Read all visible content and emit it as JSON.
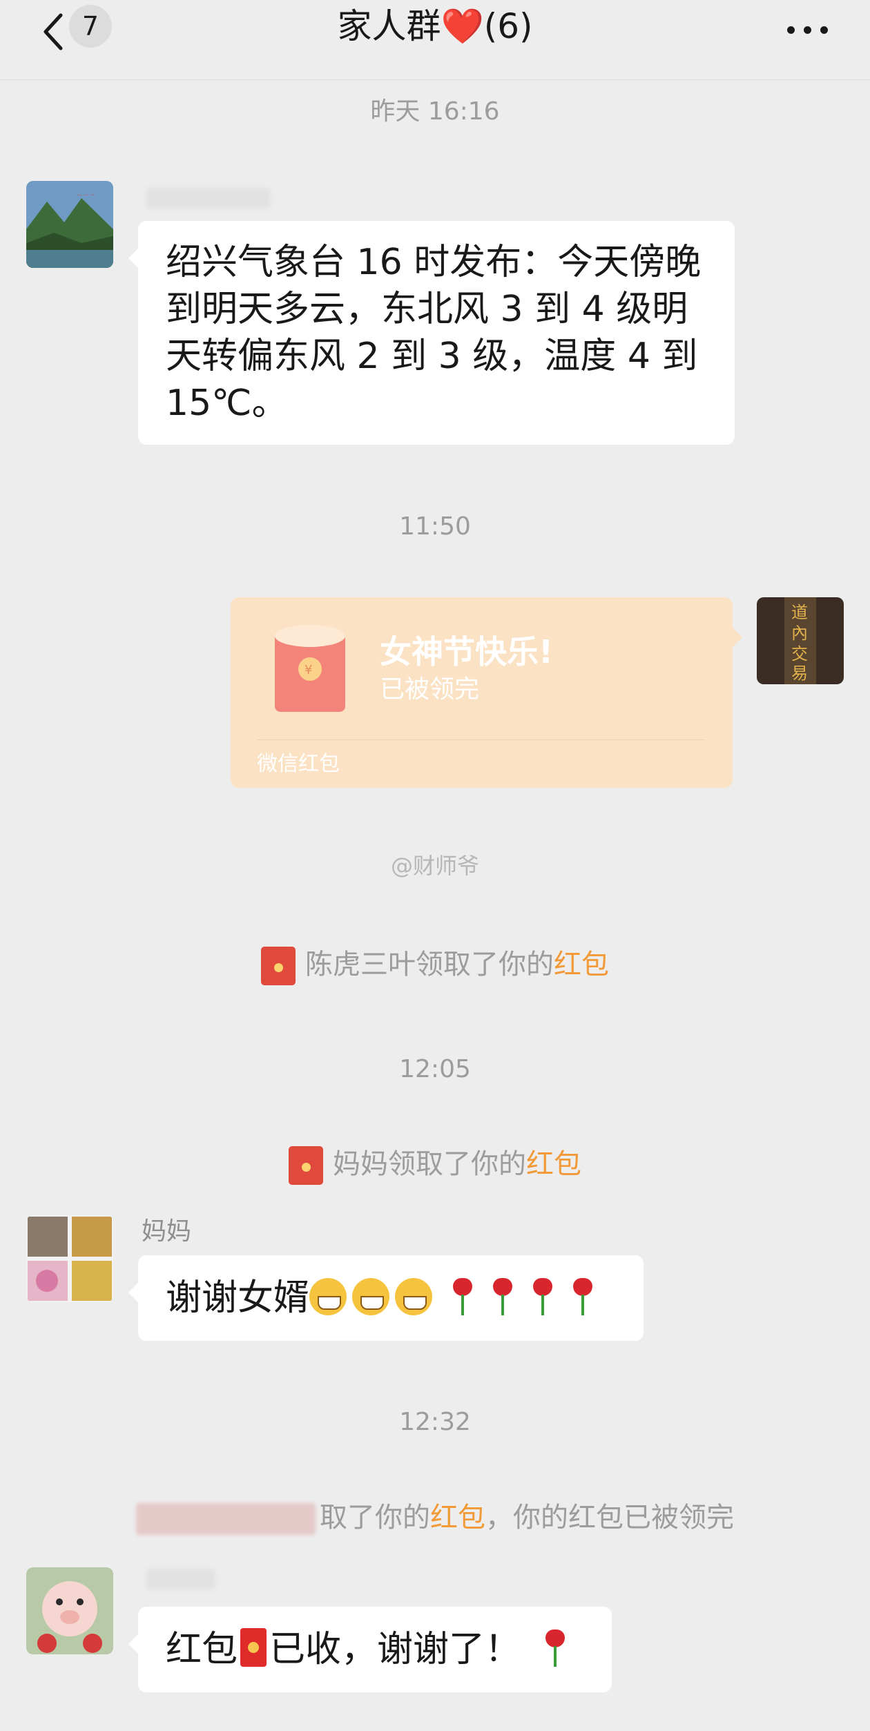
{
  "header": {
    "unread_count": "7",
    "title": "家人群",
    "title_heart": "❤️",
    "member_count": "(6)"
  },
  "timestamps": {
    "t1": "昨天 16:16",
    "t2": "11:50",
    "t3": "12:05",
    "t4": "12:32"
  },
  "messages": {
    "weather": "绍兴气象台 16 时发布：今天傍晚到明天多云，东北风 3 到 4 级明天转偏东风 2 到 3 级，温度 4 到 15℃。",
    "red_packet": {
      "title": "女神节快乐!",
      "status": "已被领完",
      "footer": "微信红包"
    },
    "mom_sender": "妈妈",
    "mom_text": "谢谢女婿",
    "last_text_prefix": "红包",
    "last_text_suffix": "已收，谢谢了！"
  },
  "notices": {
    "n1_prefix": "陈虎三叶领取了你的",
    "n1_red": "红包",
    "n2_prefix": "妈妈领取了你的",
    "n2_red": "红包",
    "n3_prefix": "取了你的",
    "n3_red": "红包",
    "n3_suffix": "，你的红包已被领完"
  },
  "watermark": "@财师爷",
  "colors": {
    "background": "#ededed",
    "bubble": "#ffffff",
    "red_packet_card": "#fbe2c4",
    "red_packet_icon": "#f3847a",
    "link_orange": "#f19a37",
    "timestamp_gray": "#9c9c9c"
  },
  "icons": {
    "back": "chevron-left-icon",
    "more": "more-dots-icon",
    "red_packet": "red-packet-icon"
  }
}
